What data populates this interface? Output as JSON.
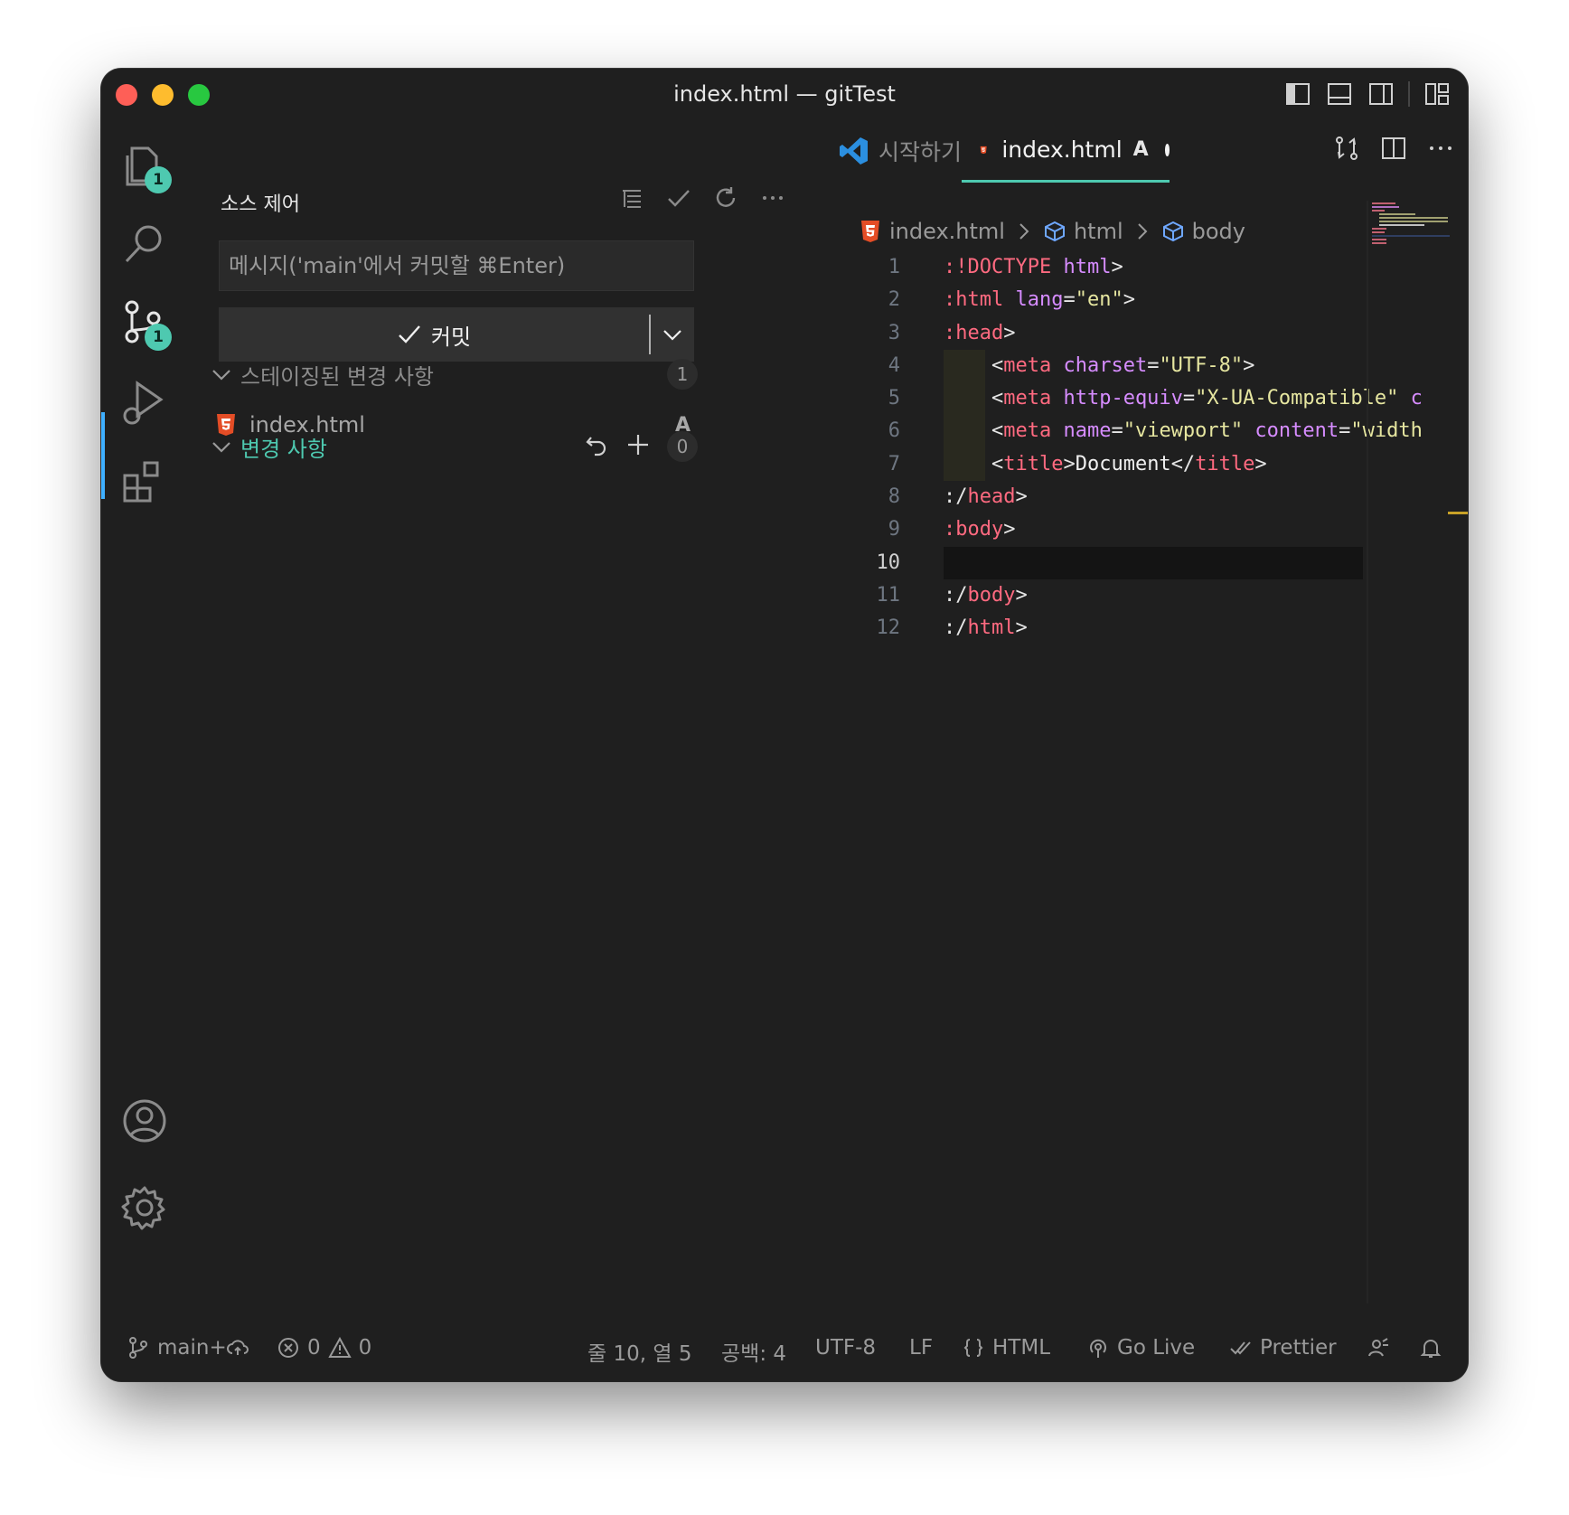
{
  "window": {
    "title": "index.html — gitTest"
  },
  "activity_bar": {
    "explorer_badge": "1",
    "scm_badge": "1"
  },
  "sidebar": {
    "title": "소스 제어",
    "commit_message_placeholder": "메시지('main'에서 커밋할 ⌘Enter)",
    "commit_button_label": "커밋",
    "staged_group": {
      "label": "스테이징된 변경 사항",
      "count": "1"
    },
    "staged_files": [
      {
        "name": "index.html",
        "status": "A"
      }
    ],
    "changes_group": {
      "label": "변경 사항",
      "count": "0"
    }
  },
  "editor": {
    "tabs": [
      {
        "label": "시작하기"
      },
      {
        "label": "index.html",
        "status": "A"
      }
    ],
    "breadcrumb": [
      "index.html",
      "html",
      "body"
    ],
    "lines": [
      {
        "num": "1"
      },
      {
        "num": "2"
      },
      {
        "num": "3"
      },
      {
        "num": "4"
      },
      {
        "num": "5"
      },
      {
        "num": "6"
      },
      {
        "num": "7"
      },
      {
        "num": "8"
      },
      {
        "num": "9"
      },
      {
        "num": "10"
      },
      {
        "num": "11"
      },
      {
        "num": "12"
      }
    ],
    "code": {
      "l1": {
        "p1": ":!DOCTYPE",
        "p2": " ",
        "p3": "html",
        "p4": ">"
      },
      "l2": {
        "p1": ":html",
        "p2": " ",
        "p3": "lang",
        "p4": "=",
        "p5": "\"en\"",
        "p6": ">"
      },
      "l3": {
        "p1": ":head",
        "p2": ">"
      },
      "l4": {
        "p1": "    <",
        "p2": "meta",
        "p3": " ",
        "p4": "charset",
        "p5": "=",
        "p6": "\"UTF-8\"",
        "p7": ">"
      },
      "l5": {
        "p1": "    <",
        "p2": "meta",
        "p3": " ",
        "p4": "http-equiv",
        "p5": "=",
        "p6": "\"X-UA-Compatible\"",
        "p7": " c"
      },
      "l6": {
        "p1": "    <",
        "p2": "meta",
        "p3": " ",
        "p4": "name",
        "p5": "=",
        "p6": "\"viewport\"",
        "p7": " ",
        "p8": "content",
        "p9": "=",
        "p10": "\"width"
      },
      "l7": {
        "p1": "    <",
        "p2": "title",
        "p3": ">",
        "p4": "Document",
        "p5": "</",
        "p6": "title",
        "p7": ">"
      },
      "l8": {
        "p1": ":/",
        "p2": "head",
        "p3": ">"
      },
      "l9": {
        "p1": ":body",
        "p2": ">"
      },
      "l11": {
        "p1": ":/",
        "p2": "body",
        "p3": ">"
      },
      "l12": {
        "p1": ":/",
        "p2": "html",
        "p3": ">"
      }
    }
  },
  "statusbar": {
    "branch": "main+",
    "errors": "0",
    "warnings": "0",
    "cursor": "줄 10, 열 5",
    "indent": "공백: 4",
    "encoding": "UTF-8",
    "eol": "LF",
    "language": "HTML",
    "golive": "Go Live",
    "prettier": "Prettier"
  },
  "colors": {
    "accent": "#4ec9b0",
    "html_icon": "#e44d26",
    "tag": "#ff6a80",
    "attr": "#d68cff",
    "string": "#e6e6a0"
  }
}
